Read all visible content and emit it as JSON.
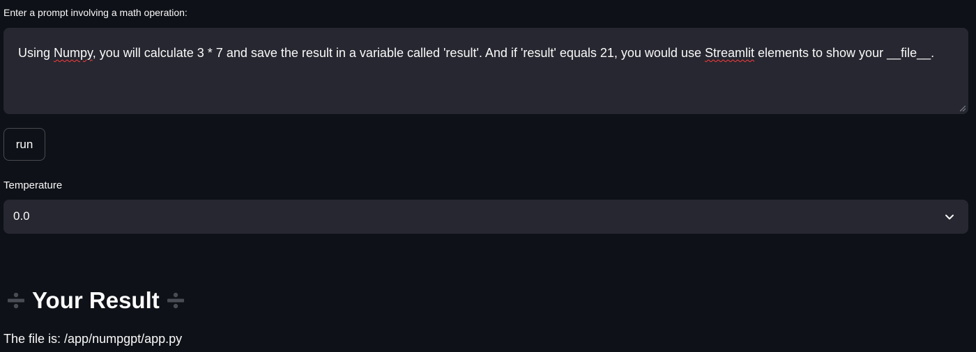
{
  "prompt": {
    "label": "Enter a prompt involving a math operation:",
    "text_part1": "Using ",
    "word_numpy": "Numpy",
    "text_part2": ", you will calculate 3 * 7 and save the result in a variable called 'result'. And if 'result' equals 21, you would use ",
    "word_streamlit": "Streamlit",
    "text_part3": " elements to show your __file__."
  },
  "run_button": {
    "label": "run"
  },
  "temperature": {
    "label": "Temperature",
    "selected_value": "0.0"
  },
  "result": {
    "icon": "divide-icon",
    "title": "Your Result",
    "file_line": "The file is: /app/numpgpt/app.py"
  },
  "colors": {
    "background": "#0e1117",
    "input_background": "#262730",
    "text": "#fafafa",
    "spellcheck": "#ff3b3b"
  }
}
